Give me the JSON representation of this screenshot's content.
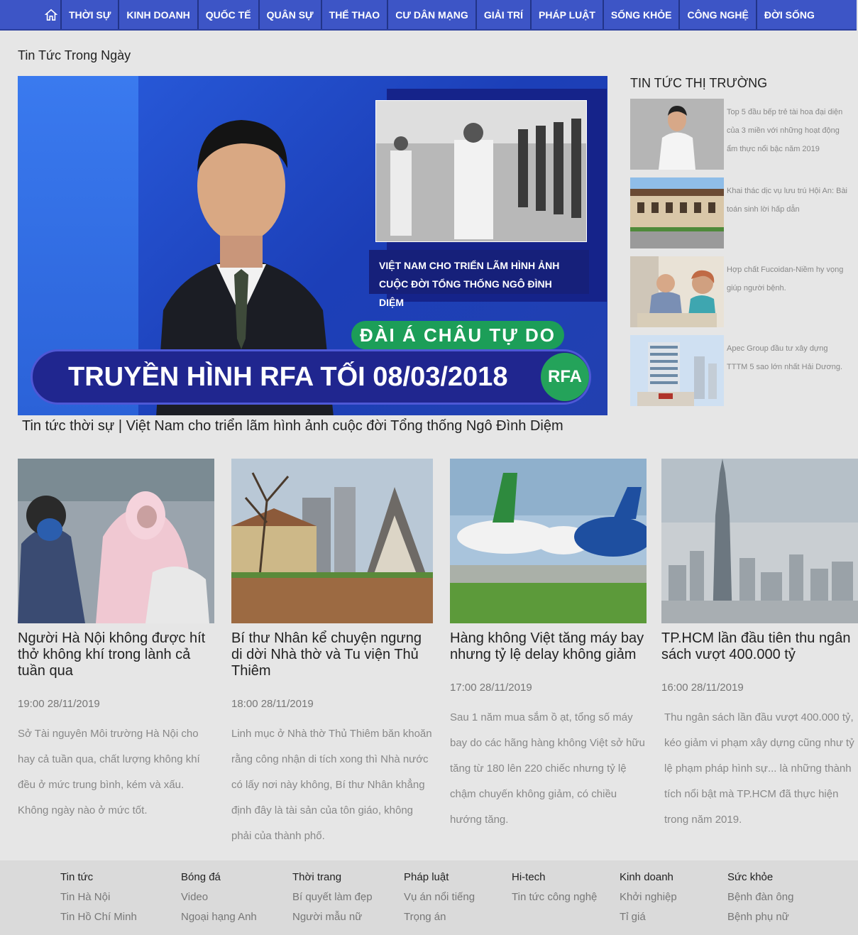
{
  "nav": {
    "items": [
      "THỜI SỰ",
      "KINH DOANH",
      "QUỐC TẾ",
      "QUÂN SỰ",
      "THỂ THAO",
      "CƯ DÂN MẠNG",
      "GIẢI TRÍ",
      "PHÁP LUẬT",
      "SỐNG KHỎE",
      "CÔNG NGHỆ",
      "ĐỜI SỐNG"
    ],
    "accent": "#3d55c6"
  },
  "page_title": "Tin Tức Trong Ngày",
  "hero": {
    "caption_line1": "VIỆT NAM CHO TRIỂN LÃM HÌNH ẢNH",
    "caption_line2": "CUỘC ĐỜI TỔNG THỐNG NGÔ ĐÌNH DIỆM",
    "station": "ĐÀI Á CHÂU TỰ DO",
    "banner": "TRUYỀN HÌNH RFA TỐI 08/03/2018",
    "logo": "RFA",
    "title": "Tin tức thời sự | Việt Nam cho triển lãm  hình ảnh cuộc đời Tổng thống Ngô Đình Diệm"
  },
  "sidebar": {
    "title": "TIN TỨC THỊ TRƯỜNG",
    "items": [
      {
        "text": "Top 5 đầu bếp trẻ tài hoa đại diện của 3 miền với những hoạt động ẩm thực nổi bậc năm 2019"
      },
      {
        "text": "Khai thác dịc vụ lưu trú Hội An: Bài toán sinh lời hấp dẫn"
      },
      {
        "text": "Hợp chất Fucoidan-Niềm hy vọng giúp người bệnh."
      },
      {
        "text": "Apec Group đầu tư xây dựng TTTM 5 sao lớn nhất Hải Dương."
      }
    ]
  },
  "cards": [
    {
      "title": "Người Hà Nội không được hít thở không khí trong lành cả tuần qua",
      "date": "19:00 28/11/2019",
      "desc": "Sở Tài nguyên Môi trường Hà Nội cho hay cả tuần qua, chất lượng không khí đều ở mức trung bình, kém và xấu. Không ngày nào ở mức tốt."
    },
    {
      "title": "Bí thư Nhân kể chuyện ngưng di dời Nhà thờ và Tu viện Thủ Thiêm",
      "date": "18:00 28/11/2019",
      "desc": "Linh mục ở Nhà thờ Thủ Thiêm băn khoăn rằng công nhận di tích xong thì Nhà nước có lấy nơi này không, Bí thư Nhân khẳng định đây là tài sản của tôn giáo, không phải của thành phố."
    },
    {
      "title": "Hàng không Việt tăng máy bay nhưng tỷ lệ delay không giảm",
      "date": "17:00 28/11/2019",
      "desc": "Sau 1 năm mua sắm ồ ạt, tổng số máy bay do các hãng hàng không Việt sở hữu tăng từ 180 lên 220 chiếc nhưng tỷ lệ chậm chuyến không giảm, có chiều hướng tăng."
    },
    {
      "title": "TP.HCM lần đầu tiên thu ngân sách vượt 400.000 tỷ",
      "date": "16:00 28/11/2019",
      "desc": "Thu ngân sách lần đầu vượt 400.000 tỷ, kéo giảm vi phạm xây dựng cũng như tỷ lệ phạm pháp hình sự... là những thành tích nổi bật mà TP.HCM đã thực hiện trong năm 2019."
    }
  ],
  "footer": {
    "columns": [
      {
        "head": "Tin tức",
        "links": [
          "Tin Hà Nội",
          "Tin Hồ Chí Minh"
        ]
      },
      {
        "head": "Bóng đá",
        "links": [
          "Video",
          "Ngoại hạng Anh"
        ]
      },
      {
        "head": "Thời trang",
        "links": [
          "Bí quyết làm đẹp",
          "Người mẫu nữ"
        ]
      },
      {
        "head": "Pháp luật",
        "links": [
          "Vụ án nổi tiếng",
          "Trọng án"
        ]
      },
      {
        "head": "Hi-tech",
        "links": [
          "Tin tức công nghệ"
        ]
      },
      {
        "head": "Kinh doanh",
        "links": [
          "Khởi nghiệp",
          "Tỉ giá"
        ]
      },
      {
        "head": "Sức khỏe",
        "links": [
          "Bệnh đàn ông",
          "Bệnh phụ nữ"
        ]
      }
    ]
  }
}
